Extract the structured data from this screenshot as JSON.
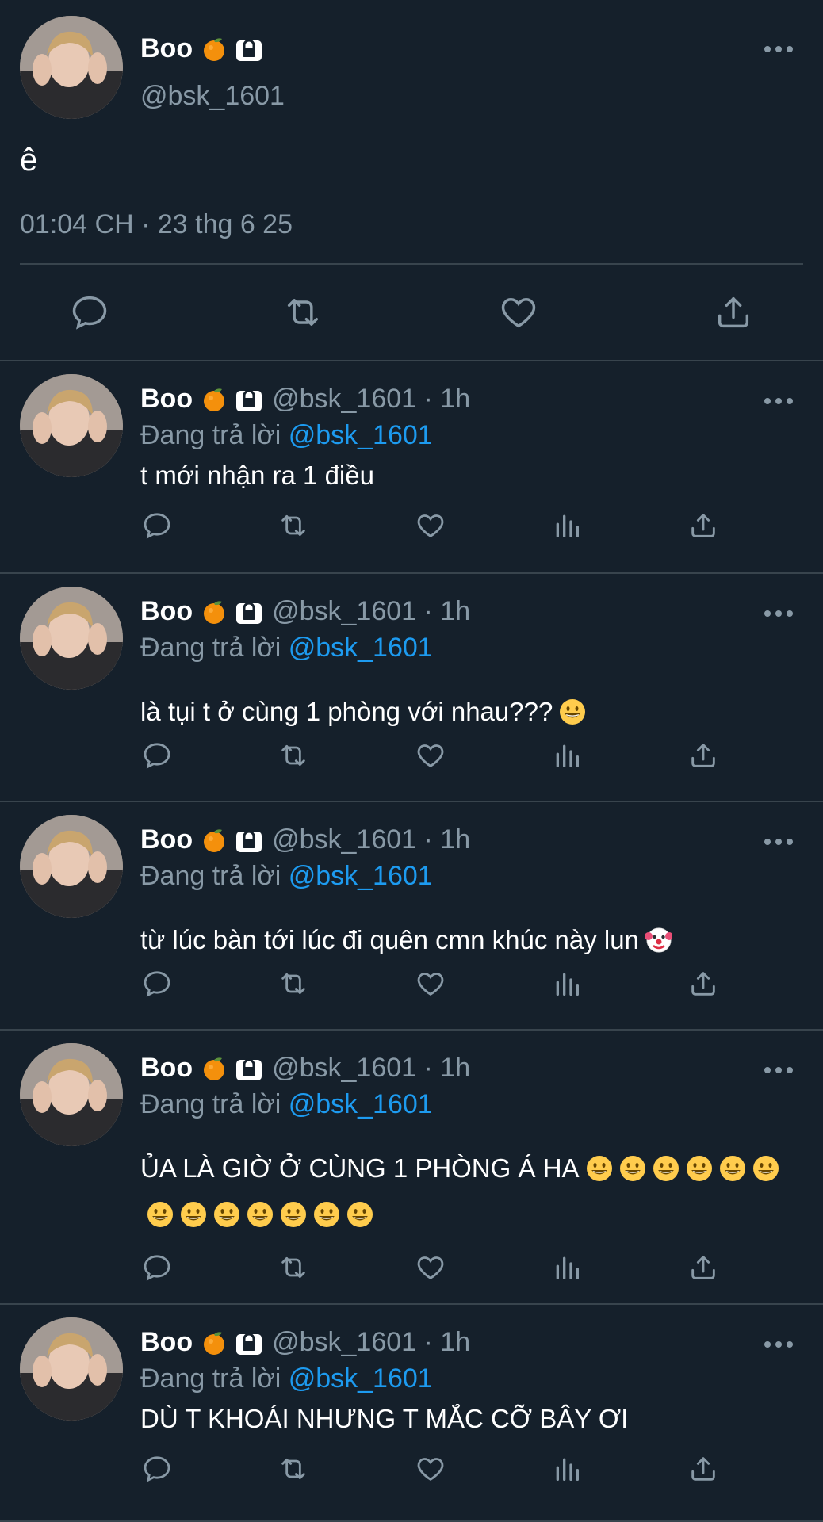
{
  "user": {
    "display_name": "Boo",
    "handle": "@bsk_1601",
    "fruit_icon": "tangerine-emoji",
    "lock_icon": "protected-lock-icon"
  },
  "main_tweet": {
    "text": "ê",
    "timestamp": "01:04 CH · 23 thg 6 25"
  },
  "replies": [
    {
      "handle_time": "@bsk_1601 · 1h",
      "replying_label": "Đang trả lời",
      "replying_to": "@bsk_1601",
      "text": "t mới nhận ra 1 điều",
      "emojis": []
    },
    {
      "handle_time": "@bsk_1601 · 1h",
      "replying_label": "Đang trả lời",
      "replying_to": "@bsk_1601",
      "text": "là tụi t ở cùng 1 phòng với nhau???",
      "emojis": [
        "grinning"
      ]
    },
    {
      "handle_time": "@bsk_1601 · 1h",
      "replying_label": "Đang trả lời",
      "replying_to": "@bsk_1601",
      "text": "từ lúc bàn tới lúc đi quên cmn khúc này lun",
      "emojis": [
        "clown"
      ]
    },
    {
      "handle_time": "@bsk_1601 · 1h",
      "replying_label": "Đang trả lời",
      "replying_to": "@bsk_1601",
      "text": "ỦA LÀ GIỜ Ở CÙNG 1 PHÒNG Á HA",
      "emojis": [
        "grinning",
        "grinning",
        "grinning",
        "grinning",
        "grinning",
        "grinning",
        "grinning",
        "grinning",
        "grinning",
        "grinning",
        "grinning",
        "grinning",
        "grinning"
      ]
    },
    {
      "handle_time": "@bsk_1601 · 1h",
      "replying_label": "Đang trả lời",
      "replying_to": "@bsk_1601",
      "text": "DÙ T KHOÁI NHƯNG T MẮC CỠ BÂY ƠI",
      "emojis": []
    }
  ],
  "colors": {
    "background": "#15202b",
    "divider": "#38444d",
    "secondary_text": "#8899a6",
    "mention": "#1d9bf0"
  }
}
